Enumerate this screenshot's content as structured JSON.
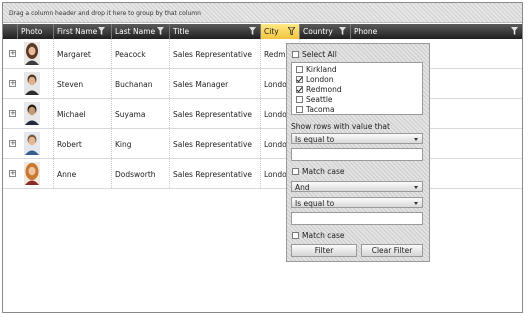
{
  "group_panel": {
    "hint": "Drag a column header and drop it here to group by that column"
  },
  "columns": [
    {
      "key": "photo",
      "label": "Photo",
      "filtered": false
    },
    {
      "key": "first",
      "label": "First Name",
      "filtered": false
    },
    {
      "key": "last",
      "label": "Last Name",
      "filtered": false
    },
    {
      "key": "title",
      "label": "Title",
      "filtered": false
    },
    {
      "key": "city",
      "label": "City",
      "filtered": true
    },
    {
      "key": "country",
      "label": "Country",
      "filtered": false
    },
    {
      "key": "phone",
      "label": "Phone",
      "filtered": false
    }
  ],
  "rows": [
    {
      "first": "Margaret",
      "last": "Peacock",
      "title": "Sales Representative",
      "city": "Redm",
      "photo": "woman-photo"
    },
    {
      "first": "Steven",
      "last": "Buchanan",
      "title": "Sales Manager",
      "city": "Londo",
      "photo": "man-photo"
    },
    {
      "first": "Michael",
      "last": "Suyama",
      "title": "Sales Representative",
      "city": "Londo",
      "photo": "man-photo"
    },
    {
      "first": "Robert",
      "last": "King",
      "title": "Sales Representative",
      "city": "Londo",
      "photo": "man-photo"
    },
    {
      "first": "Anne",
      "last": "Dodsworth",
      "title": "Sales Representative",
      "city": "Londo",
      "photo": "woman-photo"
    }
  ],
  "filter": {
    "select_all": {
      "label": "Select All",
      "checked": false
    },
    "distinct_values": [
      {
        "label": "Kirkland",
        "checked": false
      },
      {
        "label": "London",
        "checked": true
      },
      {
        "label": "Redmond",
        "checked": true
      },
      {
        "label": "Seattle",
        "checked": false
      },
      {
        "label": "Tacoma",
        "checked": false
      }
    ],
    "show_rows_label": "Show rows with value that",
    "operator1": "Is equal to",
    "value1": "",
    "match_case1": {
      "label": "Match case",
      "checked": false
    },
    "logical_operator": "And",
    "operator2": "Is equal to",
    "value2": "",
    "match_case2": {
      "label": "Match case",
      "checked": false
    },
    "filter_button": "Filter",
    "clear_button": "Clear Filter"
  },
  "colors": {
    "header_dark": "#2b2b2b",
    "active_header": "#f5cf4f",
    "panel_bg": "#e3e3e3"
  },
  "icons": {
    "filter": "funnel-icon",
    "expand": "expand-plus-icon"
  }
}
